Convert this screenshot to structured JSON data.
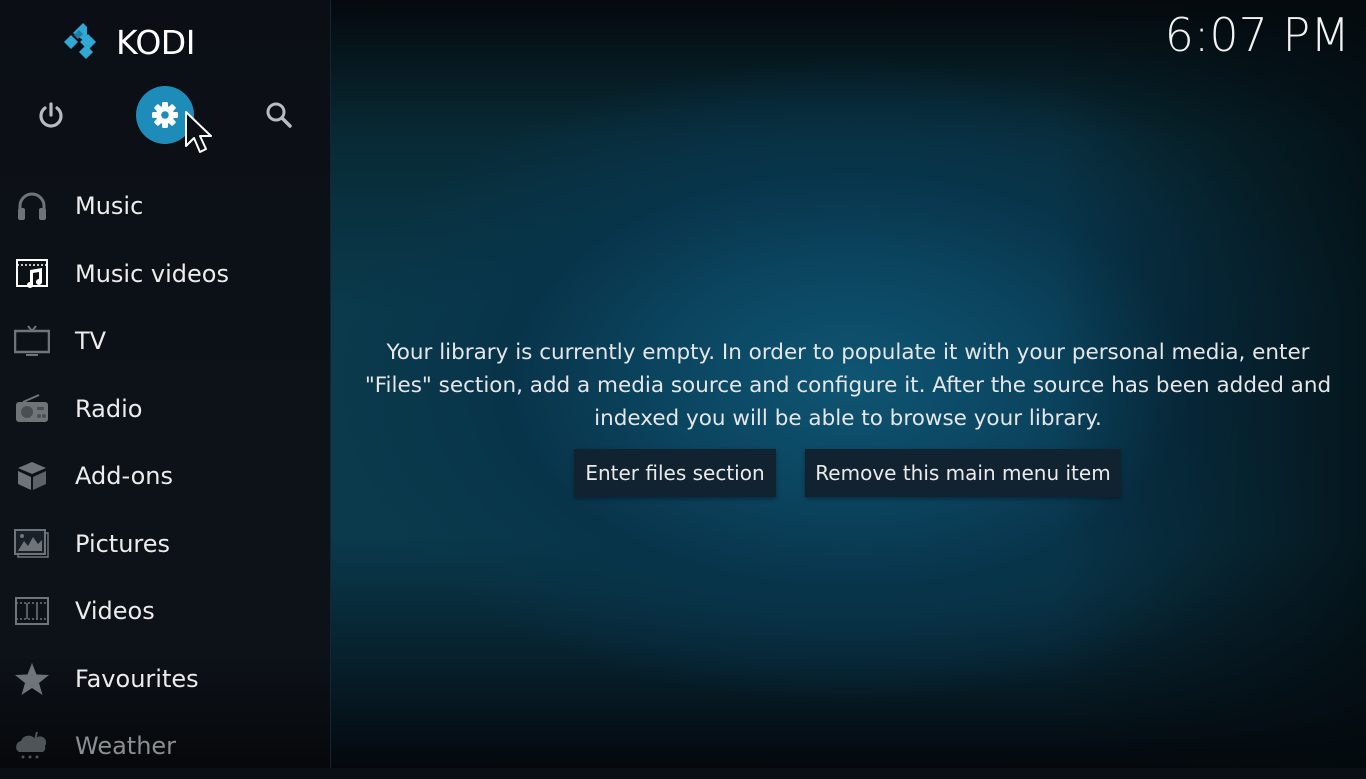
{
  "app": {
    "name": "KODI",
    "clock": "6:07 PM",
    "accent_color": "#1d8cb9"
  },
  "top_buttons": [
    {
      "name": "power",
      "icon": "power-icon"
    },
    {
      "name": "settings",
      "icon": "gear-icon",
      "focused": true
    },
    {
      "name": "search",
      "icon": "search-icon"
    }
  ],
  "menu": {
    "items": [
      {
        "label": "Music",
        "icon": "headphones-icon"
      },
      {
        "label": "Music videos",
        "icon": "music-video-icon",
        "selected": true
      },
      {
        "label": "TV",
        "icon": "tv-icon"
      },
      {
        "label": "Radio",
        "icon": "radio-icon"
      },
      {
        "label": "Add-ons",
        "icon": "addons-box-icon"
      },
      {
        "label": "Pictures",
        "icon": "pictures-icon"
      },
      {
        "label": "Videos",
        "icon": "film-icon"
      },
      {
        "label": "Favourites",
        "icon": "star-icon"
      },
      {
        "label": "Weather",
        "icon": "weather-icon"
      }
    ]
  },
  "main": {
    "message": "Your library is currently empty. In order to populate it with your personal media, enter \"Files\" section, add a media source and configure it. After the source has been added and indexed you will be able to browse your library.",
    "buttons": {
      "enter_files": "Enter files section",
      "remove_item": "Remove this main menu item"
    }
  }
}
